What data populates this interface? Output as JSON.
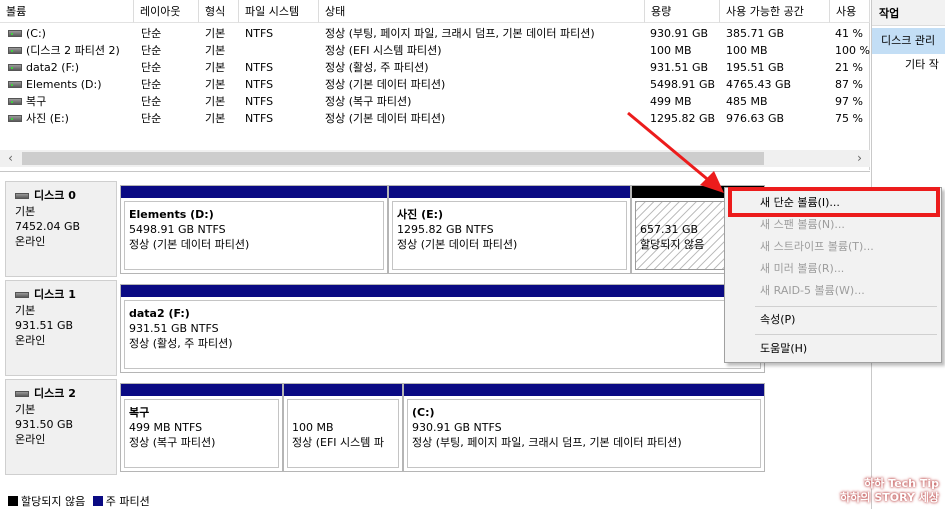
{
  "columns": [
    "볼륨",
    "레이아웃",
    "형식",
    "파일 시스템",
    "상태",
    "용량",
    "사용 가능한 공간",
    "사용"
  ],
  "volumes": [
    {
      "name": "(C:)",
      "layout": "단순",
      "type": "기본",
      "fs": "NTFS",
      "status": "정상 (부팅, 페이지 파일, 크래시 덤프, 기본 데이터 파티션)",
      "capacity": "930.91 GB",
      "free": "385.71 GB",
      "pct": "41 %"
    },
    {
      "name": "(디스크 2 파티션 2)",
      "layout": "단순",
      "type": "기본",
      "fs": "",
      "status": "정상 (EFI 시스템 파티션)",
      "capacity": "100 MB",
      "free": "100 MB",
      "pct": "100 %"
    },
    {
      "name": "data2 (F:)",
      "layout": "단순",
      "type": "기본",
      "fs": "NTFS",
      "status": "정상 (활성, 주 파티션)",
      "capacity": "931.51 GB",
      "free": "195.51 GB",
      "pct": "21 %"
    },
    {
      "name": "Elements (D:)",
      "layout": "단순",
      "type": "기본",
      "fs": "NTFS",
      "status": "정상 (기본 데이터 파티션)",
      "capacity": "5498.91 GB",
      "free": "4765.43 GB",
      "pct": "87 %"
    },
    {
      "name": "복구",
      "layout": "단순",
      "type": "기본",
      "fs": "NTFS",
      "status": "정상 (복구 파티션)",
      "capacity": "499 MB",
      "free": "485 MB",
      "pct": "97 %"
    },
    {
      "name": "사진 (E:)",
      "layout": "단순",
      "type": "기본",
      "fs": "NTFS",
      "status": "정상 (기본 데이터 파티션)",
      "capacity": "1295.82 GB",
      "free": "976.63 GB",
      "pct": "75 %"
    }
  ],
  "scrollbar": {
    "left": "‹",
    "right": "›"
  },
  "action_pane": {
    "title": "작업",
    "selected": "디스크 관리",
    "item": "기타 작"
  },
  "disks": [
    {
      "name": "디스크 0",
      "type": "기본",
      "size": "7452.04 GB",
      "status": "온라인",
      "partitions": [
        {
          "title": "Elements  (D:)",
          "size": "5498.91 GB NTFS",
          "status": "정상 (기본 데이터 파티션)"
        },
        {
          "title": "사진  (E:)",
          "size": "1295.82 GB NTFS",
          "status": "정상 (기본 데이터 파티션)"
        },
        {
          "title": "",
          "size": "657.31 GB",
          "status": "할당되지 않음"
        }
      ]
    },
    {
      "name": "디스크 1",
      "type": "기본",
      "size": "931.51 GB",
      "status": "온라인",
      "partitions": [
        {
          "title": "data2  (F:)",
          "size": "931.51 GB NTFS",
          "status": "정상 (활성, 주 파티션)"
        }
      ]
    },
    {
      "name": "디스크 2",
      "type": "기본",
      "size": "931.50 GB",
      "status": "온라인",
      "partitions": [
        {
          "title": "복구",
          "size": "499 MB NTFS",
          "status": "정상 (복구 파티션)"
        },
        {
          "title": "",
          "size": "100 MB",
          "status": "정상 (EFI 시스템 파"
        },
        {
          "title": "(C:)",
          "size": "930.91 GB NTFS",
          "status": "정상 (부팅, 페이지 파일, 크래시 덤프, 기본 데이터 파티션)"
        }
      ]
    }
  ],
  "legend": {
    "unallocated": "할당되지 않음",
    "primary": "주 파티션"
  },
  "context_menu": {
    "new_simple": "새 단순 볼륨(I)...",
    "new_spanned": "새 스팬 볼륨(N)...",
    "new_striped": "새 스트라이프 볼륨(T)...",
    "new_mirror": "새 미러 볼륨(R)...",
    "new_raid5": "새 RAID-5 볼륨(W)...",
    "properties": "속성(P)",
    "help": "도움말(H)"
  },
  "watermark": {
    "line1": "하하 Tech Tip",
    "line2": "하하의 STORY 세상"
  },
  "colors": {
    "primary_partition": "#0a0a83",
    "unallocated": "#000000",
    "highlight": "#ec1c1c",
    "action_selected": "#c3def5"
  }
}
